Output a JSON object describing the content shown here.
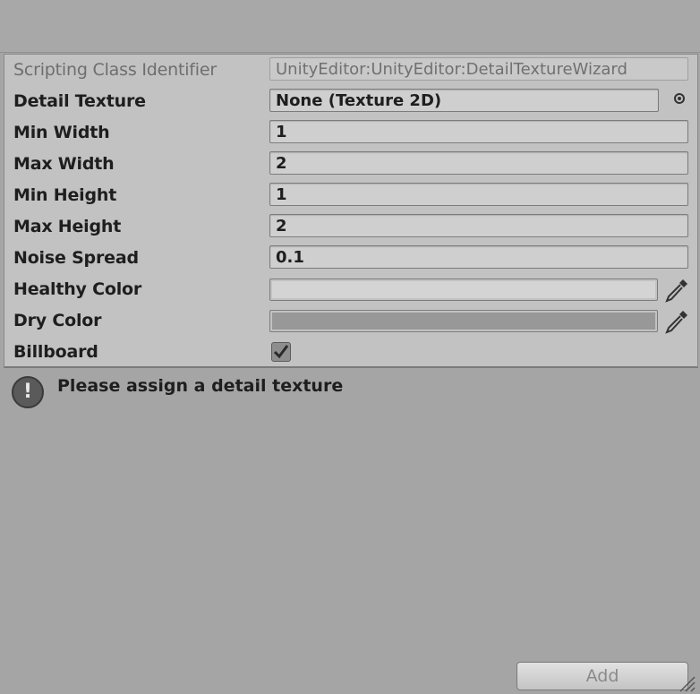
{
  "header": {},
  "inspector": {
    "script_row": {
      "label": "Scripting Class Identifier",
      "value": "UnityEditor:UnityEditor:DetailTextureWizard"
    },
    "detail_texture": {
      "label": "Detail Texture",
      "value": "None (Texture 2D)"
    },
    "min_width": {
      "label": "Min Width",
      "value": "1"
    },
    "max_width": {
      "label": "Max Width",
      "value": "2"
    },
    "min_height": {
      "label": "Min Height",
      "value": "1"
    },
    "max_height": {
      "label": "Max Height",
      "value": "2"
    },
    "noise_spread": {
      "label": "Noise Spread",
      "value": "0.1"
    },
    "healthy_color": {
      "label": "Healthy Color",
      "color": "#d4d4d4"
    },
    "dry_color": {
      "label": "Dry Color",
      "color": "#989898"
    },
    "billboard": {
      "label": "Billboard",
      "checked": true
    }
  },
  "help": {
    "icon": "warning-icon",
    "text": "Please assign a detail texture"
  },
  "footer": {
    "add_label": "Add"
  }
}
